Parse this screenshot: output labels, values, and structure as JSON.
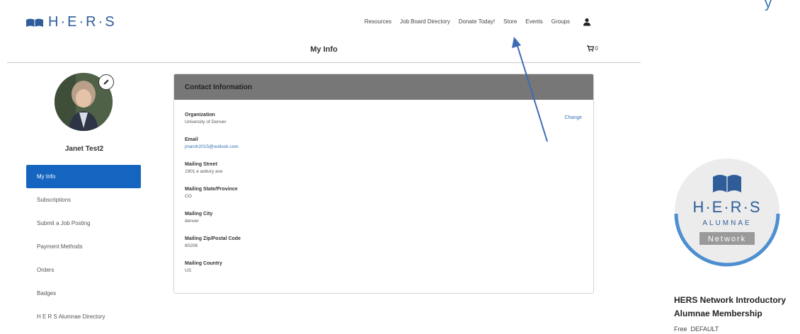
{
  "brand": {
    "logo_text": "H·E·R·S",
    "accent": "#2e5d9a"
  },
  "cropped_text": "y",
  "nav": {
    "items": [
      "Resources",
      "Job Board Directory",
      "Donate Today!",
      "Store",
      "Events",
      "Groups"
    ],
    "user_icon": "user-icon"
  },
  "page": {
    "title": "My Info",
    "cart_count": "0"
  },
  "profile": {
    "name": "Janet Test2"
  },
  "sidebar": {
    "items": [
      {
        "label": "My Info",
        "active": true
      },
      {
        "label": "Subscriptions"
      },
      {
        "label": "Submit a Job Posting"
      },
      {
        "label": "Payment Methods"
      },
      {
        "label": "Orders"
      },
      {
        "label": "Badges"
      },
      {
        "label": "H E R S Alumnae Directory"
      }
    ]
  },
  "contact": {
    "header": "Contact Information",
    "change_label": "Change",
    "fields": [
      {
        "label": "Organization",
        "value": "University of Denver"
      },
      {
        "label": "Email",
        "value": "jmarsh2015@outlook.com"
      },
      {
        "label": "Mailing Street",
        "value": "1901 e asbury ave"
      },
      {
        "label": "Mailing State/Province",
        "value": "CO"
      },
      {
        "label": "Mailing City",
        "value": "denver"
      },
      {
        "label": "Mailing Zip/Postal Code",
        "value": "80208"
      },
      {
        "label": "Mailing Country",
        "value": "US"
      }
    ]
  },
  "product": {
    "badge_lines": [
      "H·E·R·S",
      "ALUMNAE",
      "Network"
    ],
    "name": "HERS Network Introductory Alumnae Membership",
    "price": "Free",
    "tier": "DEFAULT"
  }
}
